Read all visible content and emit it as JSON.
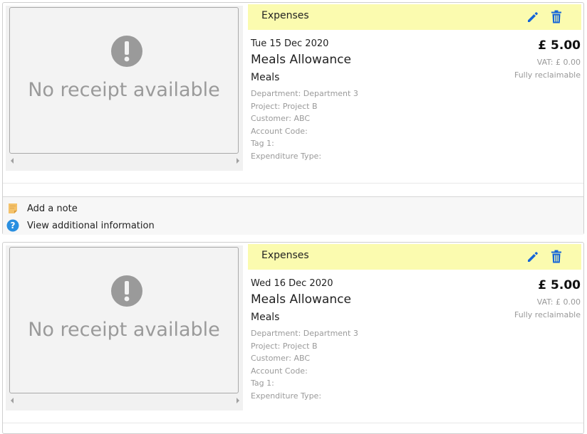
{
  "expenses": [
    {
      "header_title": "Expenses",
      "receipt_text": "No receipt available",
      "date": "Tue 15 Dec 2020",
      "title": "Meals Allowance",
      "category": "Meals",
      "meta": [
        "Department: Department 3",
        "Project: Project B",
        "Customer: ABC",
        "Account Code:",
        "Tag 1:",
        "Expenditure Type:"
      ],
      "amount": "£ 5.00",
      "vat": "VAT: £ 0.00",
      "reclaim": "Fully reclaimable",
      "footer": {
        "add_note": "Add a note",
        "view_info": "View additional information"
      }
    },
    {
      "header_title": "Expenses",
      "receipt_text": "No receipt available",
      "date": "Wed 16 Dec 2020",
      "title": "Meals Allowance",
      "category": "Meals",
      "meta": [
        "Department: Department 3",
        "Project: Project B",
        "Customer: ABC",
        "Account Code:",
        "Tag 1:",
        "Expenditure Type:"
      ],
      "amount": "£ 5.00",
      "vat": "VAT: £ 0.00",
      "reclaim": "Fully reclaimable"
    }
  ],
  "colors": {
    "header_bg": "#fbfbaf",
    "icon_blue": "#1565d8",
    "muted_text": "#9a9a9a",
    "note_icon": "#f4c26a",
    "info_icon": "#2a8fe0"
  }
}
